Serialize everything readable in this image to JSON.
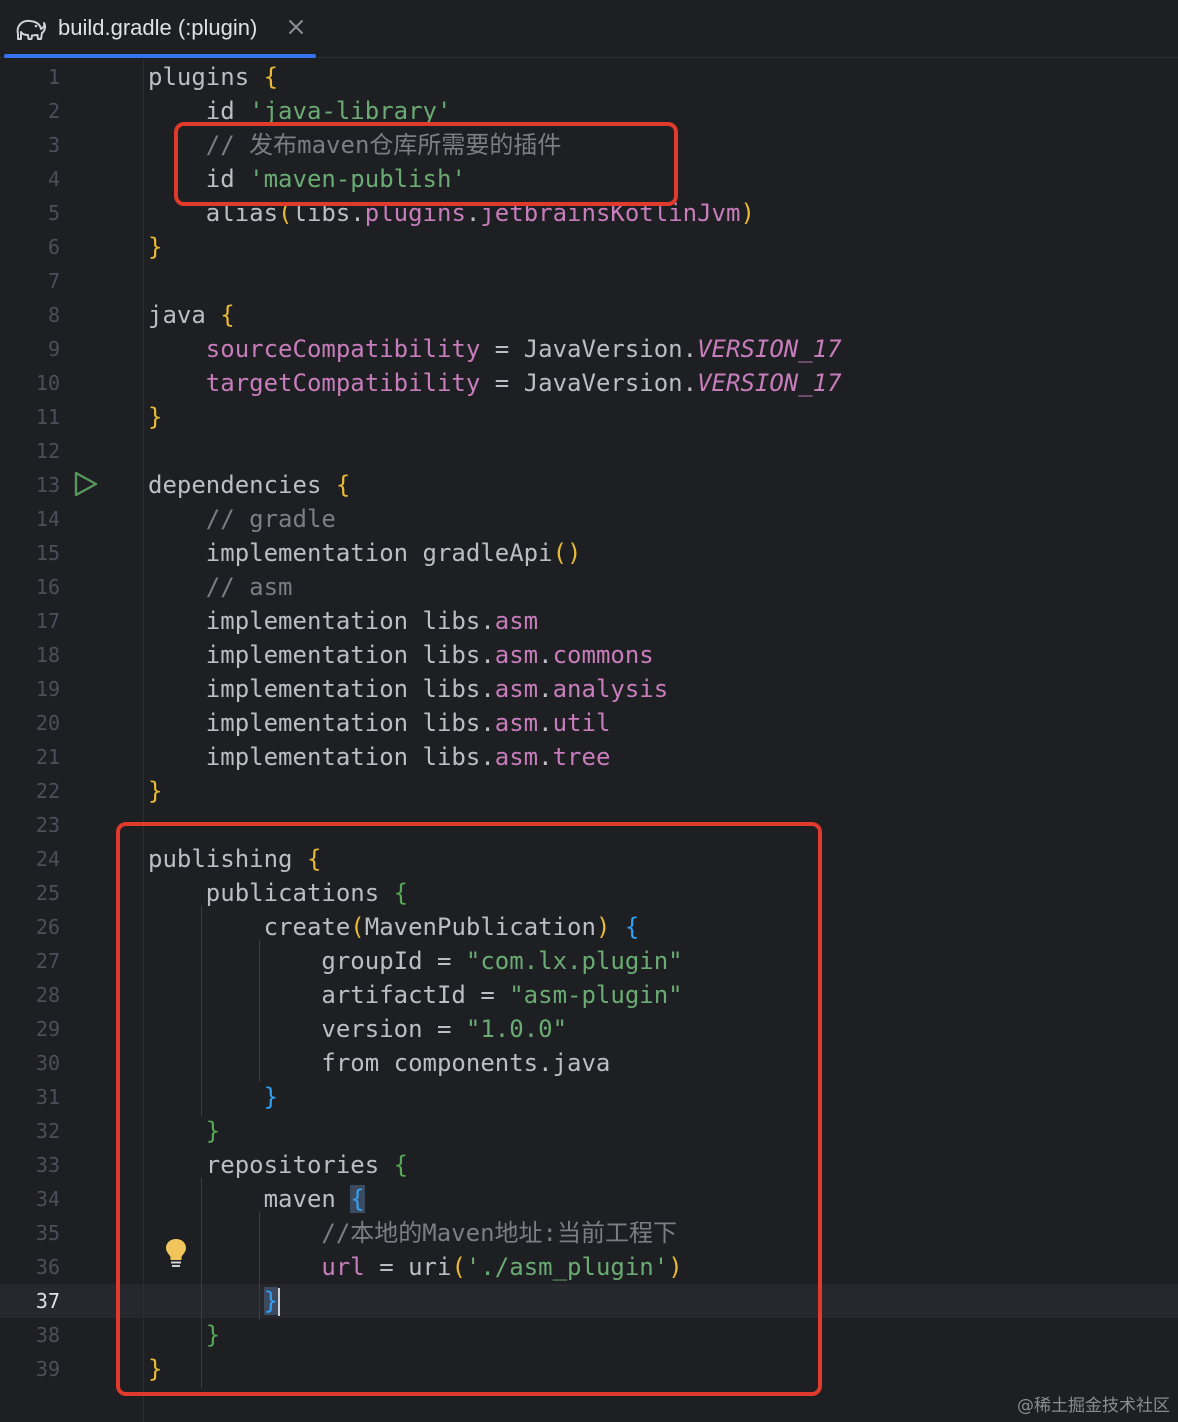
{
  "tab": {
    "title": "build.gradle (:plugin)",
    "icon": "gradle-elephant-icon",
    "close_icon": "close-icon"
  },
  "editor": {
    "current_line": 37,
    "lines": [
      {
        "n": "1",
        "tokens": [
          [
            "plugins ",
            "plain"
          ],
          [
            "{",
            "b-gold"
          ]
        ]
      },
      {
        "n": "2",
        "tokens": [
          [
            "    id ",
            "plain"
          ],
          [
            "'java-library'",
            "str"
          ]
        ]
      },
      {
        "n": "3",
        "tokens": [
          [
            "    // 发布maven仓库所需要的插件",
            "com"
          ]
        ]
      },
      {
        "n": "4",
        "tokens": [
          [
            "    id ",
            "plain"
          ],
          [
            "'maven-publish'",
            "str"
          ]
        ]
      },
      {
        "n": "5",
        "tokens": [
          [
            "    alias",
            "plain"
          ],
          [
            "(",
            "b-gold"
          ],
          [
            "libs.",
            "plain"
          ],
          [
            "plugins",
            "prop"
          ],
          [
            ".",
            "plain"
          ],
          [
            "jetbrainsKotlinJvm",
            "prop"
          ],
          [
            ")",
            "b-gold"
          ]
        ]
      },
      {
        "n": "6",
        "tokens": [
          [
            "}",
            "b-gold"
          ]
        ]
      },
      {
        "n": "7",
        "tokens": []
      },
      {
        "n": "8",
        "tokens": [
          [
            "java ",
            "plain"
          ],
          [
            "{",
            "b-gold"
          ]
        ]
      },
      {
        "n": "9",
        "tokens": [
          [
            "    ",
            "plain"
          ],
          [
            "sourceCompatibility",
            "prop"
          ],
          [
            " = JavaVersion.",
            "plain"
          ],
          [
            "VERSION_17",
            "ital"
          ]
        ]
      },
      {
        "n": "10",
        "tokens": [
          [
            "    ",
            "plain"
          ],
          [
            "targetCompatibility",
            "prop"
          ],
          [
            " = JavaVersion.",
            "plain"
          ],
          [
            "VERSION_17",
            "ital"
          ]
        ]
      },
      {
        "n": "11",
        "tokens": [
          [
            "}",
            "b-gold"
          ]
        ]
      },
      {
        "n": "12",
        "tokens": []
      },
      {
        "n": "13",
        "tokens": [
          [
            "dependencies ",
            "plain"
          ],
          [
            "{",
            "b-gold"
          ]
        ]
      },
      {
        "n": "14",
        "tokens": [
          [
            "    // gradle",
            "com"
          ]
        ]
      },
      {
        "n": "15",
        "tokens": [
          [
            "    implementation gradleApi",
            "plain"
          ],
          [
            "()",
            "b-gold"
          ]
        ]
      },
      {
        "n": "16",
        "tokens": [
          [
            "    // asm",
            "com"
          ]
        ]
      },
      {
        "n": "17",
        "tokens": [
          [
            "    implementation libs.",
            "plain"
          ],
          [
            "asm",
            "prop"
          ]
        ]
      },
      {
        "n": "18",
        "tokens": [
          [
            "    implementation libs.",
            "plain"
          ],
          [
            "asm",
            "prop"
          ],
          [
            ".",
            "plain"
          ],
          [
            "commons",
            "prop"
          ]
        ]
      },
      {
        "n": "19",
        "tokens": [
          [
            "    implementation libs.",
            "plain"
          ],
          [
            "asm",
            "prop"
          ],
          [
            ".",
            "plain"
          ],
          [
            "analysis",
            "prop"
          ]
        ]
      },
      {
        "n": "20",
        "tokens": [
          [
            "    implementation libs.",
            "plain"
          ],
          [
            "asm",
            "prop"
          ],
          [
            ".",
            "plain"
          ],
          [
            "util",
            "prop"
          ]
        ]
      },
      {
        "n": "21",
        "tokens": [
          [
            "    implementation libs.",
            "plain"
          ],
          [
            "asm",
            "prop"
          ],
          [
            ".",
            "plain"
          ],
          [
            "tree",
            "prop"
          ]
        ]
      },
      {
        "n": "22",
        "tokens": [
          [
            "}",
            "b-gold"
          ]
        ]
      },
      {
        "n": "23",
        "tokens": []
      },
      {
        "n": "24",
        "tokens": [
          [
            "publishing ",
            "plain"
          ],
          [
            "{",
            "b-gold"
          ]
        ]
      },
      {
        "n": "25",
        "tokens": [
          [
            "    publications ",
            "plain"
          ],
          [
            "{",
            "b-green"
          ]
        ]
      },
      {
        "n": "26",
        "tokens": [
          [
            "        create",
            "plain"
          ],
          [
            "(",
            "b-gold"
          ],
          [
            "MavenPublication",
            "plain"
          ],
          [
            ")",
            "b-gold"
          ],
          [
            " ",
            "plain"
          ],
          [
            "{",
            "b-blue"
          ]
        ]
      },
      {
        "n": "27",
        "tokens": [
          [
            "            groupId = ",
            "plain"
          ],
          [
            "\"com.lx.plugin\"",
            "str"
          ]
        ]
      },
      {
        "n": "28",
        "tokens": [
          [
            "            artifactId = ",
            "plain"
          ],
          [
            "\"asm-plugin\"",
            "str"
          ]
        ]
      },
      {
        "n": "29",
        "tokens": [
          [
            "            version = ",
            "plain"
          ],
          [
            "\"1.0.0\"",
            "str"
          ]
        ]
      },
      {
        "n": "30",
        "tokens": [
          [
            "            from components.java",
            "plain"
          ]
        ]
      },
      {
        "n": "31",
        "tokens": [
          [
            "        ",
            "plain"
          ],
          [
            "}",
            "b-blue"
          ]
        ]
      },
      {
        "n": "32",
        "tokens": [
          [
            "    ",
            "plain"
          ],
          [
            "}",
            "b-green"
          ]
        ]
      },
      {
        "n": "33",
        "tokens": [
          [
            "    repositories ",
            "plain"
          ],
          [
            "{",
            "b-green"
          ]
        ]
      },
      {
        "n": "34",
        "tokens": [
          [
            "        maven ",
            "plain"
          ],
          [
            "{",
            "b-blue-hl"
          ]
        ]
      },
      {
        "n": "35",
        "tokens": [
          [
            "            //本地的Maven地址:当前工程下",
            "com"
          ]
        ]
      },
      {
        "n": "36",
        "tokens": [
          [
            "            ",
            "plain"
          ],
          [
            "url",
            "prop"
          ],
          [
            " = uri",
            "plain"
          ],
          [
            "(",
            "b-gold"
          ],
          [
            "'./asm_plugin'",
            "str"
          ],
          [
            ")",
            "b-gold"
          ]
        ]
      },
      {
        "n": "37",
        "tokens": [
          [
            "        ",
            "plain"
          ],
          [
            "}",
            "b-blue-hl"
          ],
          [
            "|",
            "caret"
          ]
        ]
      },
      {
        "n": "38",
        "tokens": [
          [
            "    ",
            "plain"
          ],
          [
            "}",
            "b-green"
          ]
        ]
      },
      {
        "n": "39",
        "tokens": [
          [
            "}",
            "b-gold"
          ]
        ]
      }
    ]
  },
  "gutter": {
    "run_icon": "run-gutter-icon",
    "bulb_icon": "intention-bulb-icon"
  },
  "annotations": {
    "highlight_color": "#e03a2c"
  },
  "watermark": "@稀土掘金技术社区"
}
